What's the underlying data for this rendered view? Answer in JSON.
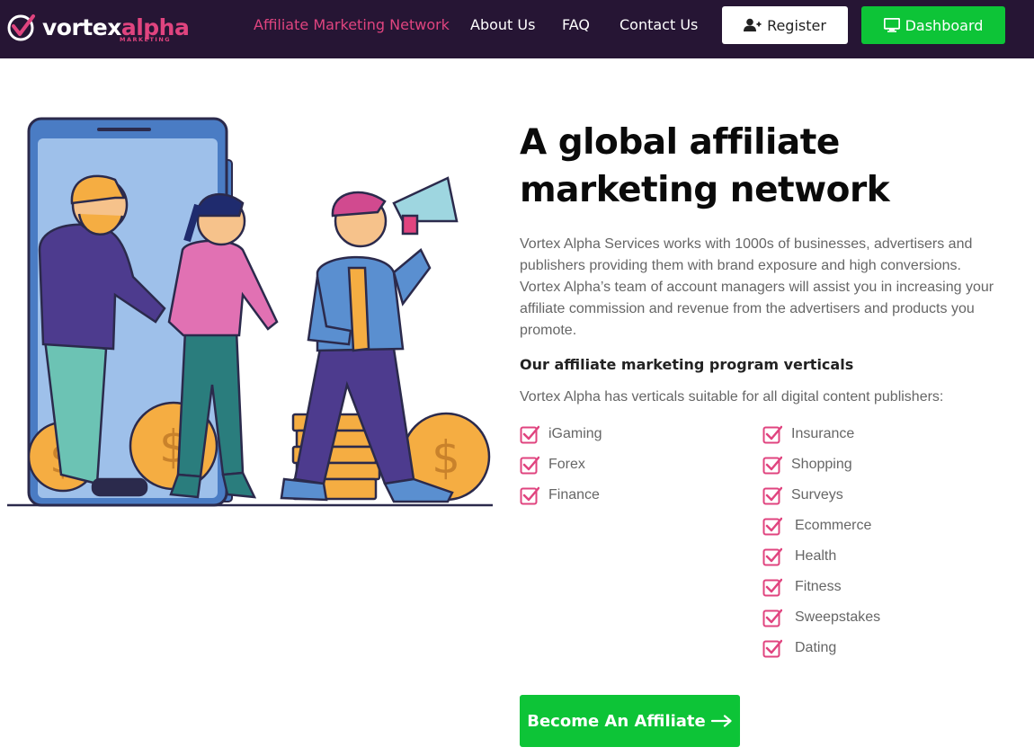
{
  "brand": {
    "word_main": "vortex",
    "word_accent": "alpha",
    "tagline": "MARKETING"
  },
  "nav": {
    "links": [
      "Affiliate Marketing Network",
      "About Us",
      "FAQ",
      "Contact Us"
    ],
    "register_label": "Register",
    "dashboard_label": "Dashboard"
  },
  "hero": {
    "title_line1": "A global affiliate",
    "title_line2": "marketing network",
    "intro": "Vortex Alpha Services works with 1000s of businesses, advertisers and publishers providing them with brand exposure and high conversions. Vortex Alpha’s team of account managers will assist you in increasing your affiliate commission and revenue from the advertisers and products you promote.",
    "subhead": "Our affiliate marketing program verticals",
    "subtext": "Vortex Alpha has verticals suitable for all digital content publishers:"
  },
  "verticals_left": [
    "iGaming",
    "Forex",
    "Finance"
  ],
  "verticals_right": [
    "Insurance",
    "Shopping",
    "Surveys",
    "Ecommerce",
    "Health",
    "Fitness",
    "Sweepstakes",
    "Dating"
  ],
  "cta": {
    "label": "Become An Affiliate"
  },
  "colors": {
    "header_bg": "#261534",
    "accent_pink": "#e0447f",
    "green": "#0dc437"
  },
  "icons": {
    "register": "user-plus-icon",
    "dashboard": "desktop-icon",
    "check": "checkbox-icon",
    "arrow": "arrow-right-icon"
  }
}
